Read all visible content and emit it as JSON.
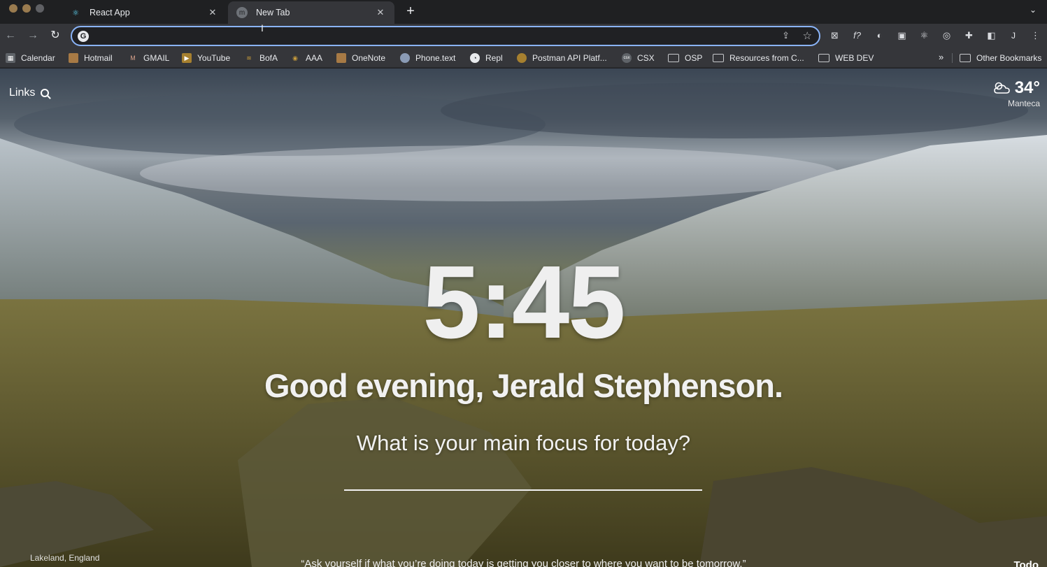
{
  "browser": {
    "tabs": [
      {
        "title": "React App",
        "icon": "react-icon",
        "active": false
      },
      {
        "title": "New Tab",
        "icon": "momentum-icon",
        "active": true
      }
    ],
    "tab_close_glyph": "✕",
    "new_tab_glyph": "+",
    "omnibox": {
      "value": "",
      "placeholder": ""
    },
    "profile_initial": "J"
  },
  "bookmarks": {
    "items": [
      {
        "label": "Calendar",
        "icon": "calendar-icon",
        "color": "#8ab4f8"
      },
      {
        "label": "Hotmail",
        "icon": "hotmail-icon",
        "color": "#c58b4f"
      },
      {
        "label": "GMAIL",
        "icon": "gmail-icon",
        "color": "#d9a28b"
      },
      {
        "label": "YouTube",
        "icon": "youtube-icon",
        "color": "#c59a3c"
      },
      {
        "label": "BofA",
        "icon": "bofa-icon",
        "color": "#c59a3c"
      },
      {
        "label": "AAA",
        "icon": "aaa-icon",
        "color": "#c59a3c"
      },
      {
        "label": "OneNote",
        "icon": "onenote-icon",
        "color": "#c58b4f"
      },
      {
        "label": "Phone.text",
        "icon": "phone-text-icon",
        "color": "#8ab4f8"
      },
      {
        "label": "Repl",
        "icon": "repl-icon",
        "color": "#e8eaed"
      },
      {
        "label": "Postman API Platf...",
        "icon": "postman-icon",
        "color": "#c59a3c"
      },
      {
        "label": "CSX",
        "icon": "csx-icon",
        "color": "#9aa0a6"
      },
      {
        "label": "OSP",
        "icon": "folder-icon",
        "color": "#c7c9cc"
      },
      {
        "label": "Resources from C...",
        "icon": "folder-icon",
        "color": "#c7c9cc"
      },
      {
        "label": "WEB DEV",
        "icon": "folder-icon",
        "color": "#c7c9cc"
      }
    ],
    "overflow_glyph": "»",
    "other": "Other Bookmarks"
  },
  "page": {
    "links_label": "Links",
    "weather": {
      "temp": "34°",
      "location": "Manteca",
      "icon": "partly-cloudy-icon"
    },
    "time": "5:45",
    "greeting": "Good evening, Jerald Stephenson.",
    "focus_question": "What is your main focus for today?",
    "focus_value": "",
    "photo_credit": "Lakeland, England",
    "quote": "“Ask yourself if what you’re doing today is getting you closer to where you want to be tomorrow.”",
    "todo_label": "Todo"
  },
  "colors": {
    "accent": "#8ab4f8",
    "tabstrip": "#1f2022",
    "toolbar": "#35363a"
  }
}
